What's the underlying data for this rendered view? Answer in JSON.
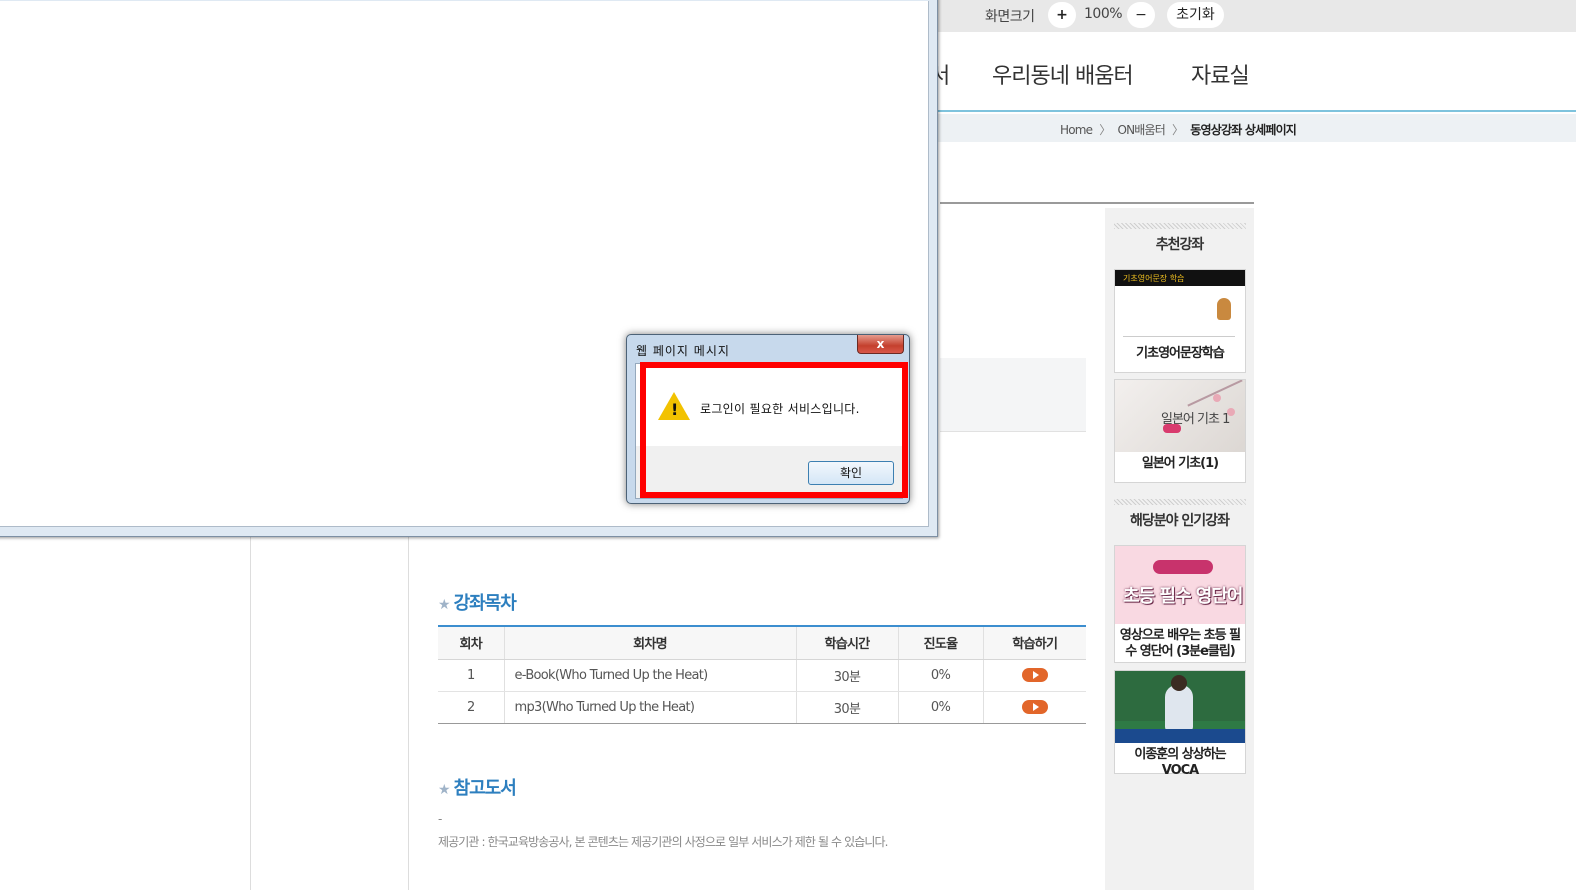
{
  "topbar": {
    "zoom_label": "화면크기",
    "zoom_in": "+",
    "zoom_value": "100%",
    "zoom_out": "−",
    "reset": "초기화"
  },
  "nav": {
    "partial_item": "서",
    "items": [
      "우리동네 배움터",
      "자료실"
    ]
  },
  "breadcrumb": {
    "home": "Home",
    "level1": "ON배움터",
    "current": "동영상강좌 상세페이지",
    "separator": "〉"
  },
  "toc": {
    "title": "강좌목차",
    "columns": [
      "회차",
      "회차명",
      "학습시간",
      "진도율",
      "학습하기"
    ],
    "rows": [
      {
        "no": "1",
        "name": "e-Book(Who Turned Up the Heat)",
        "time": "30분",
        "progress": "0%"
      },
      {
        "no": "2",
        "name": "mp3(Who Turned Up the Heat)",
        "time": "30분",
        "progress": "0%"
      }
    ]
  },
  "references": {
    "title": "참고도서",
    "dash": "-",
    "note": "제공기관 : 한국교육방송공사, 본 콘텐츠는 제공기관의 사정으로 일부 서비스가 제한 될 수 있습니다."
  },
  "sidebar": {
    "recommended_title": "추천강좌",
    "popular_title": "해당분야 인기강좌",
    "recommended": [
      {
        "label": "기초영어문장학습",
        "thumb_text": "기초영어문장 학습"
      },
      {
        "label": "일본어 기초(1)",
        "thumb_text": "일본어 기초 1"
      }
    ],
    "popular": [
      {
        "label": "영상으로 배우는 초등 필수 영단어 (3분e클립)",
        "thumb_text": "초등 필수 영단어"
      },
      {
        "label": "이종훈의 상상하는 VOCA"
      }
    ]
  },
  "dialog": {
    "title": "웹 페이지 메시지",
    "close": "x",
    "message": "로그인이 필요한 서비스입니다.",
    "ok": "확인"
  },
  "colors": {
    "accent_blue": "#2d7fbf",
    "table_top_border": "#3c8ecf",
    "play_button": "#e2662a",
    "highlight_red": "#ff0000"
  }
}
